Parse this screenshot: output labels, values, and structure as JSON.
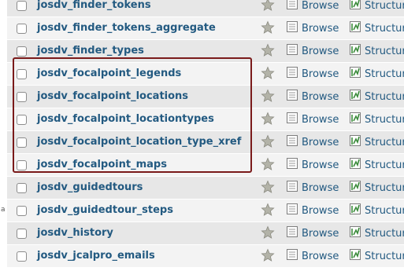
{
  "table_list": {
    "rows": [
      {
        "name": "josdv_finder_tokens"
      },
      {
        "name": "josdv_finder_tokens_aggregate"
      },
      {
        "name": "josdv_finder_types"
      },
      {
        "name": "josdv_focalpoint_legends"
      },
      {
        "name": "josdv_focalpoint_locations"
      },
      {
        "name": "josdv_focalpoint_locationtypes"
      },
      {
        "name": "josdv_focalpoint_location_type_xref"
      },
      {
        "name": "josdv_focalpoint_maps"
      },
      {
        "name": "josdv_guidedtours"
      },
      {
        "name": "josdv_guidedtour_steps"
      },
      {
        "name": "josdv_history"
      },
      {
        "name": "josdv_jcalpro_emails"
      }
    ],
    "browse_label": "Browse",
    "structure_label": "Structur"
  },
  "colors": {
    "link": "#235a81",
    "row_odd": "#e7e7e7",
    "row_even": "#f3f3f3",
    "highlight_border": "#7a1a1a"
  },
  "icons": {
    "favorite": "star-icon",
    "browse": "browse-icon",
    "structure": "structure-icon"
  }
}
